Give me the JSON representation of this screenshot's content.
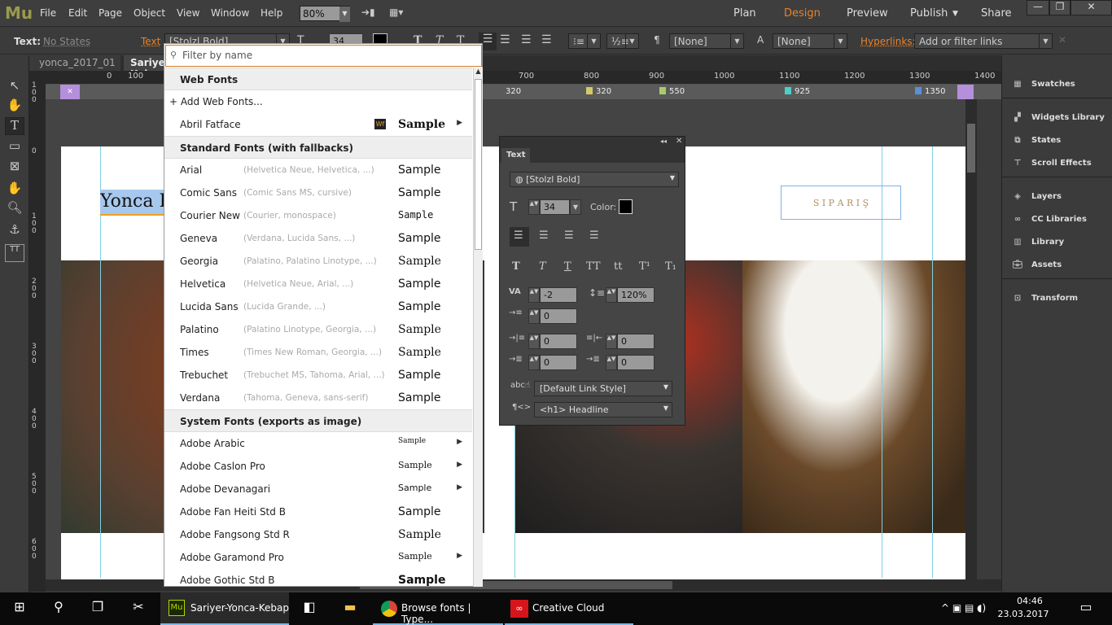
{
  "app": {
    "logo": "Mu",
    "menu": [
      "File",
      "Edit",
      "Page",
      "Object",
      "View",
      "Window",
      "Help"
    ],
    "zoom": "80%",
    "modes": [
      "Plan",
      "Design",
      "Preview",
      "Publish",
      "Share"
    ],
    "active_mode": "Design",
    "accent": "#e8822a"
  },
  "control": {
    "label": "Text:",
    "states": "No States",
    "text_link": "Text",
    "font": "[Stolzl Bold]",
    "size": "34",
    "para_style": "[None]",
    "char_style": "[None]",
    "hyperlinks_label": "Hyperlinks:",
    "hyperlinks_value": "Add or filter links"
  },
  "tabs": [
    "yonca_2017_01",
    "Sariyer-Yonca-Kebap"
  ],
  "hruler": [
    "0",
    "100",
    "700",
    "800",
    "900",
    "1000",
    "1100",
    "1200",
    "1300",
    "1400"
  ],
  "vruler": [
    "100",
    "0",
    "100",
    "200",
    "300",
    "400",
    "500",
    "600"
  ],
  "breakpoints": [
    {
      "value": "320",
      "color": "#d4c96a"
    },
    {
      "value": "320",
      "color": "#d4c96a"
    },
    {
      "value": "550",
      "color": "#a8cc6a"
    },
    {
      "value": "925",
      "color": "#4ccfc4"
    },
    {
      "value": "1350",
      "color": "#5b8fd8"
    }
  ],
  "page": {
    "heading": "Yonca K",
    "button": "S I P A R I Ş"
  },
  "font_dropdown": {
    "placeholder": "Filter by name",
    "rows": [
      {
        "type": "header",
        "name": "Web Fonts"
      },
      {
        "type": "add",
        "name": "+ Add Web Fonts..."
      },
      {
        "type": "font",
        "name": "Abril Fatface",
        "sample": "Sample",
        "badge": "Wf",
        "submenu": true
      },
      {
        "type": "header",
        "name": "Standard Fonts (with fallbacks)"
      },
      {
        "type": "font",
        "name": "Arial",
        "fallback": "(Helvetica Neue, Helvetica, ...)",
        "sample": "Sample"
      },
      {
        "type": "font",
        "name": "Comic Sans",
        "fallback": "(Comic Sans MS, cursive)",
        "sample": "Sample"
      },
      {
        "type": "font",
        "name": "Courier New",
        "fallback": "(Courier, monospace)",
        "sample": "Sample"
      },
      {
        "type": "font",
        "name": "Geneva",
        "fallback": "(Verdana, Lucida Sans, ...)",
        "sample": "Sample"
      },
      {
        "type": "font",
        "name": "Georgia",
        "fallback": "(Palatino, Palatino Linotype, ...)",
        "sample": "Sample"
      },
      {
        "type": "font",
        "name": "Helvetica",
        "fallback": "(Helvetica Neue, Arial, ...)",
        "sample": "Sample"
      },
      {
        "type": "font",
        "name": "Lucida Sans",
        "fallback": "(Lucida Grande, ...)",
        "sample": "Sample"
      },
      {
        "type": "font",
        "name": "Palatino",
        "fallback": "(Palatino Linotype, Georgia, ...)",
        "sample": "Sample"
      },
      {
        "type": "font",
        "name": "Times",
        "fallback": "(Times New Roman, Georgia, ...)",
        "sample": "Sample"
      },
      {
        "type": "font",
        "name": "Trebuchet",
        "fallback": "(Trebuchet MS, Tahoma, Arial, ...)",
        "sample": "Sample"
      },
      {
        "type": "font",
        "name": "Verdana",
        "fallback": "(Tahoma, Geneva, sans-serif)",
        "sample": "Sample"
      },
      {
        "type": "header",
        "name": "System Fonts (exports as image)"
      },
      {
        "type": "font",
        "name": "Adobe Arabic",
        "sample": "Sample",
        "submenu": true
      },
      {
        "type": "font",
        "name": "Adobe Caslon Pro",
        "sample": "Sample",
        "submenu": true
      },
      {
        "type": "font",
        "name": "Adobe Devanagari",
        "sample": "Sample",
        "submenu": true
      },
      {
        "type": "font",
        "name": "Adobe Fan Heiti Std B",
        "sample": "Sample"
      },
      {
        "type": "font",
        "name": "Adobe Fangsong Std R",
        "sample": "Sample"
      },
      {
        "type": "font",
        "name": "Adobe Garamond Pro",
        "sample": "Sample",
        "submenu": true
      },
      {
        "type": "font",
        "name": "Adobe Gothic Std B",
        "sample": "Sample"
      }
    ]
  },
  "text_panel": {
    "tab": "Text",
    "font": "[Stolzl Bold]",
    "size": "34",
    "color_label": "Color:",
    "tracking": "-2",
    "leading": "120%",
    "first_indent": "0",
    "left_indent": "0",
    "right_indent": "0",
    "space_before": "0",
    "space_after": "0",
    "link_style": "[Default Link Style]",
    "tag": "<h1> Headline",
    "styles": [
      "T",
      "T",
      "T",
      "TT",
      "tt",
      "T¹",
      "T₁"
    ]
  },
  "right_panel": [
    "Swatches",
    "Widgets Library",
    "States",
    "Scroll Effects",
    "Layers",
    "CC Libraries",
    "Library",
    "Assets",
    "Transform"
  ],
  "taskbar": {
    "apps": [
      "Sariyer-Yonca-Kebap",
      "Browse fonts | Type...",
      "Creative Cloud"
    ],
    "time": "04:46",
    "date": "23.03.2017"
  }
}
